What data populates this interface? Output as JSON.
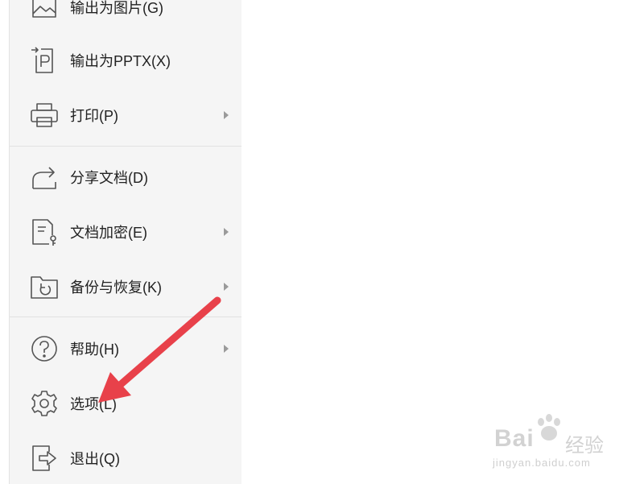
{
  "menu": {
    "items": [
      {
        "label": "输出为图片(G)",
        "icon": "image-export-icon",
        "submenu": false
      },
      {
        "label": "输出为PPTX(X)",
        "icon": "pptx-export-icon",
        "submenu": false
      },
      {
        "label": "打印(P)",
        "icon": "printer-icon",
        "submenu": true
      },
      {
        "label": "分享文档(D)",
        "icon": "share-icon",
        "submenu": false
      },
      {
        "label": "文档加密(E)",
        "icon": "document-lock-icon",
        "submenu": true
      },
      {
        "label": "备份与恢复(K)",
        "icon": "backup-restore-icon",
        "submenu": true
      },
      {
        "label": "帮助(H)",
        "icon": "help-icon",
        "submenu": true
      },
      {
        "label": "选项(L)",
        "icon": "gear-icon",
        "submenu": false
      },
      {
        "label": "退出(Q)",
        "icon": "exit-icon",
        "submenu": false
      }
    ]
  },
  "watermark": {
    "brand": "Bai",
    "brand_suffix": "经验",
    "url": "jingyan.baidu.com"
  },
  "colors": {
    "panel_bg": "#f5f5f5",
    "icon_stroke": "#555555",
    "annotation_arrow": "#e8414a"
  }
}
